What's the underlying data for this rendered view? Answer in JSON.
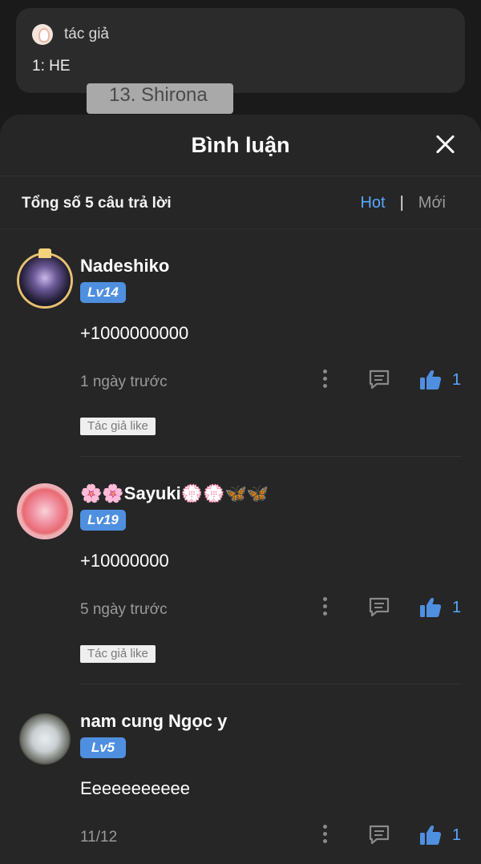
{
  "background": {
    "author_label": "tác giả",
    "author_text": "1: HE",
    "chapter_label": "13. Shirona"
  },
  "sheet": {
    "title": "Bình luận",
    "summary": "Tổng số 5 câu trả lời",
    "sort_hot": "Hot",
    "sort_sep": "|",
    "sort_new": "Mới"
  },
  "comments": [
    {
      "username": "Nadeshiko",
      "level": "Lv14",
      "content": "+1000000000",
      "time": "1 ngày trước",
      "likes": "1",
      "badge": "Tác giả like"
    },
    {
      "username": "🌸🌸Sayuki💮💮🦋🦋",
      "level": "Lv19",
      "content": "+10000000",
      "time": "5 ngày trước",
      "likes": "1",
      "badge": "Tác giả like"
    },
    {
      "username": "nam cung Ngọc y",
      "level": "Lv5",
      "content": "Eeeeeeeeeee",
      "time": "11/12",
      "likes": "1"
    }
  ],
  "colors": {
    "accent": "#5aa6ff",
    "level_badge": "#4f8fe0",
    "sheet_bg": "#262626"
  },
  "icons": {
    "close": "close-icon",
    "more": "more-vertical-icon",
    "reply": "comment-icon",
    "like": "thumbs-up-icon"
  }
}
